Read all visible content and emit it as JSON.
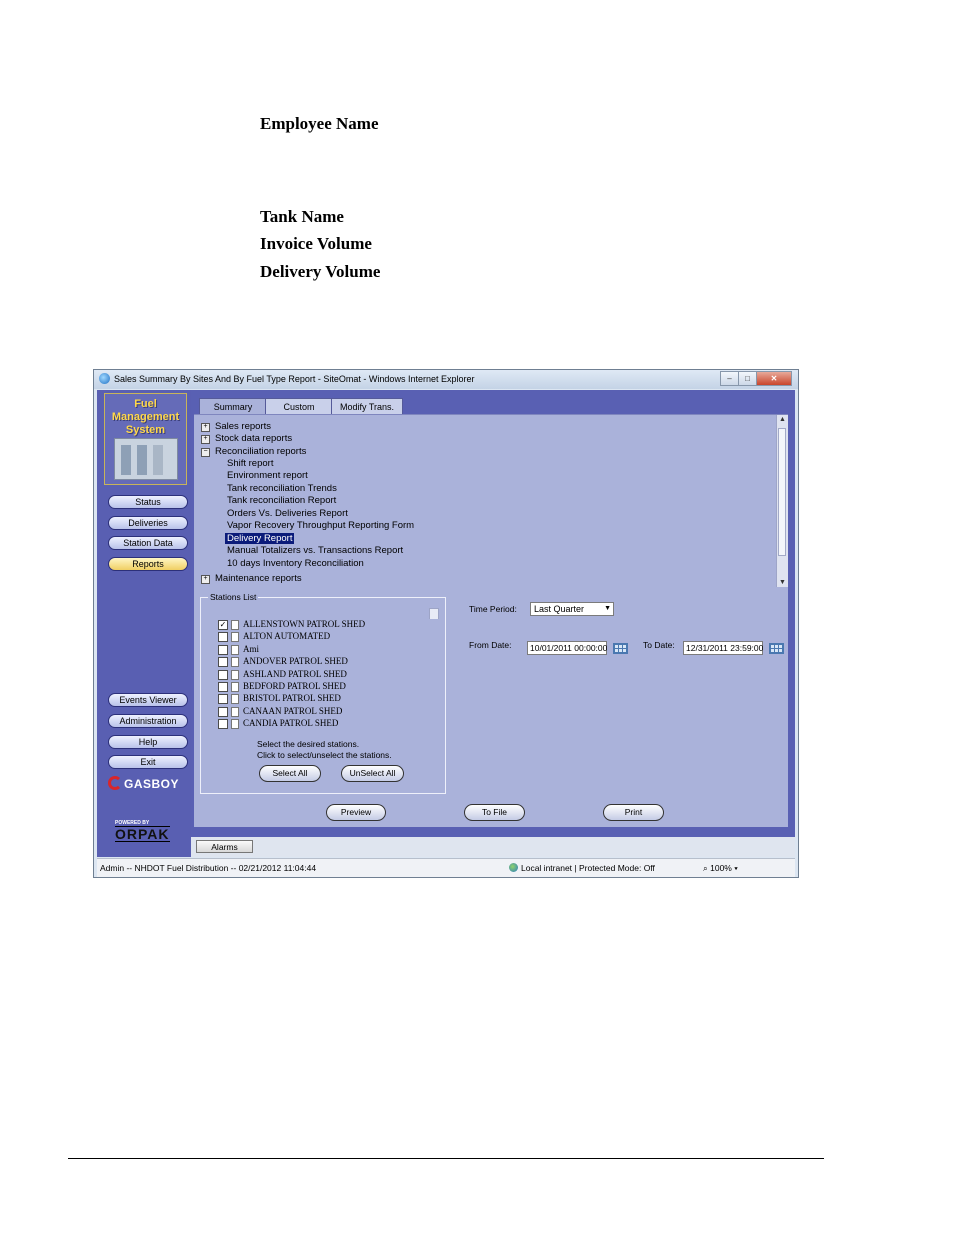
{
  "document": {
    "labels": [
      "Employee Name",
      "Tank Name",
      "Invoice Volume",
      "Delivery Volume"
    ]
  },
  "window": {
    "title": "Sales Summary By Sites And By Fuel Type Report - SiteOmat - Windows Internet Explorer",
    "controls": {
      "minimize": "–",
      "maximize": "□",
      "close": "✕"
    }
  },
  "sidebar": {
    "logo_lines": [
      "Fuel",
      "Management",
      "System"
    ],
    "nav": [
      "Status",
      "Deliveries",
      "Station Data",
      "Reports"
    ],
    "active": "Reports",
    "bottom": [
      "Events Viewer",
      "Administration",
      "Help",
      "Exit"
    ],
    "brand": "GASBOY",
    "powered": "POWERED BY",
    "orpak": "ORPAK"
  },
  "tabs": [
    "Summary",
    "Custom",
    "Modify Trans."
  ],
  "tree": {
    "top": [
      {
        "label": "Sales reports",
        "expander": "+"
      },
      {
        "label": "Stock data reports",
        "expander": "+"
      },
      {
        "label": "Reconciliation reports",
        "expander": "−"
      }
    ],
    "children": [
      "Shift report",
      "Environment report",
      "Tank reconciliation Trends",
      "Tank reconciliation Report",
      "Orders Vs. Deliveries Report",
      "Vapor Recovery Throughput Reporting Form",
      "Delivery Report",
      "Manual Totalizers vs. Transactions Report",
      "10 days Inventory Reconciliation"
    ],
    "selected": "Delivery Report",
    "cut_off": "Maintenance reports"
  },
  "stations": {
    "legend": "Stations List",
    "items": [
      {
        "name": "ALLENSTOWN PATROL SHED",
        "checked": true
      },
      {
        "name": "ALTON AUTOMATED",
        "checked": false
      },
      {
        "name": "Ami",
        "checked": false
      },
      {
        "name": "ANDOVER PATROL SHED",
        "checked": false
      },
      {
        "name": "ASHLAND PATROL SHED",
        "checked": false
      },
      {
        "name": "BEDFORD PATROL SHED",
        "checked": false
      },
      {
        "name": "BRISTOL PATROL SHED",
        "checked": false
      },
      {
        "name": "CANAAN PATROL SHED",
        "checked": false
      },
      {
        "name": "CANDIA PATROL SHED",
        "checked": false
      }
    ],
    "hint1": "Select the desired stations.",
    "hint2": "Click to select/unselect the stations.",
    "select_all": "Select All",
    "unselect_all": "UnSelect All"
  },
  "filters": {
    "time_period_label": "Time Period:",
    "time_period_value": "Last Quarter",
    "from_label": "From Date:",
    "from_value": "10/01/2011 00:00:00",
    "to_label": "To Date:",
    "to_value": "12/31/2011 23:59:00"
  },
  "actions": {
    "preview": "Preview",
    "to_file": "To File",
    "print": "Print"
  },
  "alarms": "Alarms",
  "statusbar": {
    "left": "Admin -- NHDOT Fuel Distribution -- 02/21/2012 11:04:44",
    "zone": "Local intranet | Protected Mode: Off",
    "zoom": "100%"
  }
}
